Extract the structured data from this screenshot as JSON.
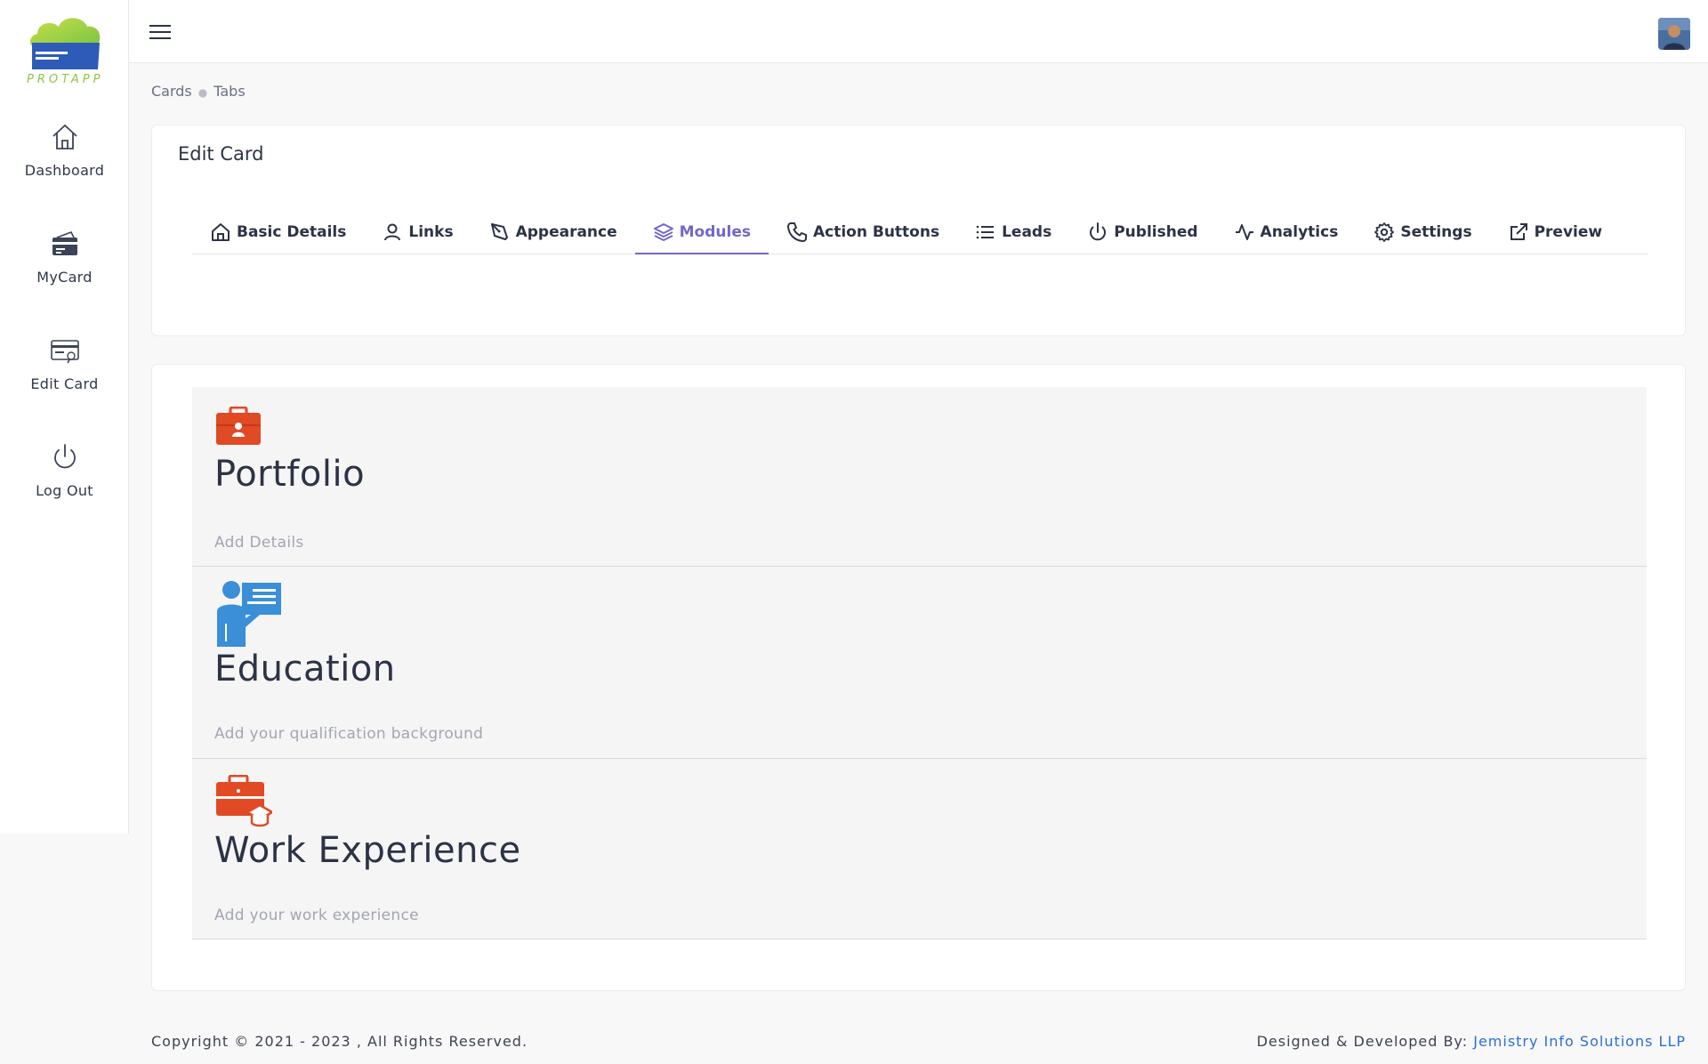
{
  "brand": {
    "logo_text": "PROTAPP"
  },
  "sidebar": {
    "items": [
      {
        "label": "Dashboard",
        "icon": "home-icon"
      },
      {
        "label": "MyCard",
        "icon": "card-icon"
      },
      {
        "label": "Edit Card",
        "icon": "edit-card-icon"
      },
      {
        "label": "Log Out",
        "icon": "power-icon"
      }
    ]
  },
  "topbar": {
    "menu_icon": "hamburger-icon",
    "avatar": "user-avatar"
  },
  "breadcrumb": [
    "Cards",
    "Tabs"
  ],
  "edit_card": {
    "title": "Edit Card",
    "active_tab": "Modules",
    "tabs": [
      {
        "label": "Basic Details",
        "icon": "home-icon"
      },
      {
        "label": "Links",
        "icon": "user-icon"
      },
      {
        "label": "Appearance",
        "icon": "pen-icon"
      },
      {
        "label": "Modules",
        "icon": "layers-icon"
      },
      {
        "label": "Action Buttons",
        "icon": "phone-icon"
      },
      {
        "label": "Leads",
        "icon": "list-icon"
      },
      {
        "label": "Published",
        "icon": "power-icon"
      },
      {
        "label": "Analytics",
        "icon": "activity-icon"
      },
      {
        "label": "Settings",
        "icon": "gear-icon"
      },
      {
        "label": "Preview",
        "icon": "external-link-icon"
      }
    ]
  },
  "modules": [
    {
      "title": "Portfolio",
      "subtitle": "Add Details",
      "icon": "portfolio-briefcase-icon"
    },
    {
      "title": "Education",
      "subtitle": "Add your qualification background",
      "icon": "teacher-board-icon"
    },
    {
      "title": "Work Experience",
      "subtitle": "Add your work experience",
      "icon": "briefcase-graduation-icon"
    }
  ],
  "footer": {
    "copyright": "Copyright © 2021 - 2023 , All Rights Reserved.",
    "credit_prefix": "Designed & Developed By: ",
    "credit_link": "Jemistry Info Solutions LLP"
  },
  "colors": {
    "accent": "#7367c9",
    "link": "#2a6fd6",
    "portfolio_icon": "#e04a24",
    "education_icon": "#3a8fd8",
    "work_icon": "#e04a24"
  }
}
